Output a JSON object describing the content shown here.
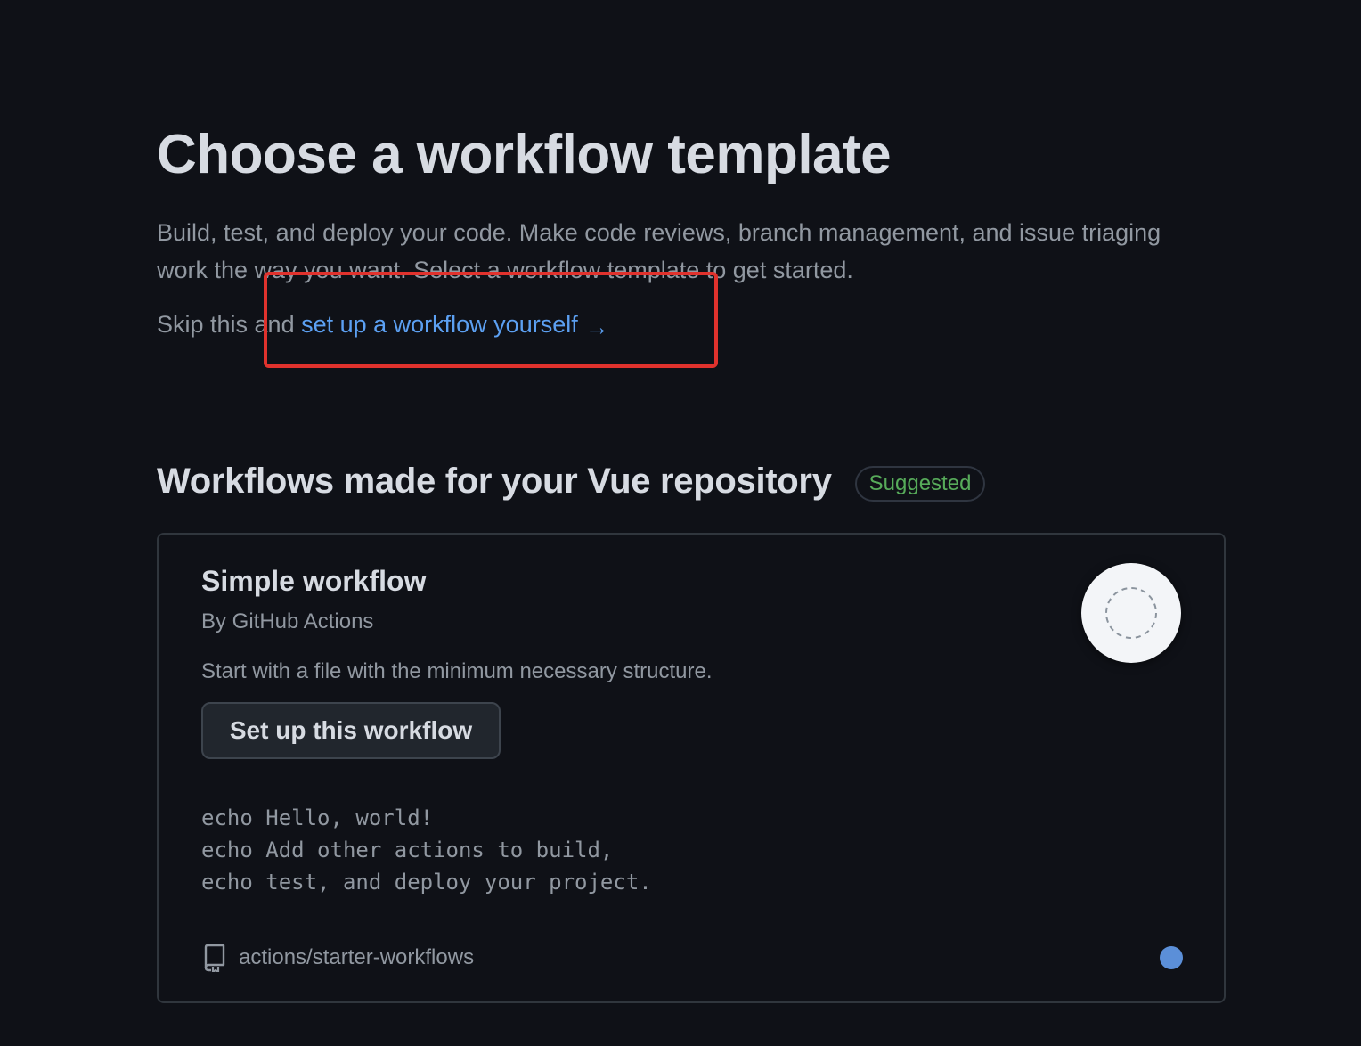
{
  "header": {
    "title": "Choose a workflow template",
    "description": "Build, test, and deploy your code. Make code reviews, branch management, and issue triaging work the way you want. Select a workflow template to get started.",
    "skip_prefix": "Skip this and ",
    "skip_link": "set up a workflow yourself",
    "skip_arrow": "→"
  },
  "section": {
    "title": "Workflows made for your Vue repository",
    "badge": "Suggested"
  },
  "card": {
    "title": "Simple workflow",
    "author": "By GitHub Actions",
    "description": "Start with a file with the minimum necessary structure.",
    "button_label": "Set up this workflow",
    "code": "echo Hello, world!\necho Add other actions to build,\necho test, and deploy your project.",
    "repo": "actions/starter-workflows",
    "logo_icon": "workflow-dashed-circle-icon",
    "repo_icon": "repo-icon"
  },
  "colors": {
    "background": "#0f1117",
    "link": "#5ca0f2",
    "badge_text": "#57ab5a",
    "highlight": "#e0322d",
    "language_dot": "#5b8fd8"
  }
}
